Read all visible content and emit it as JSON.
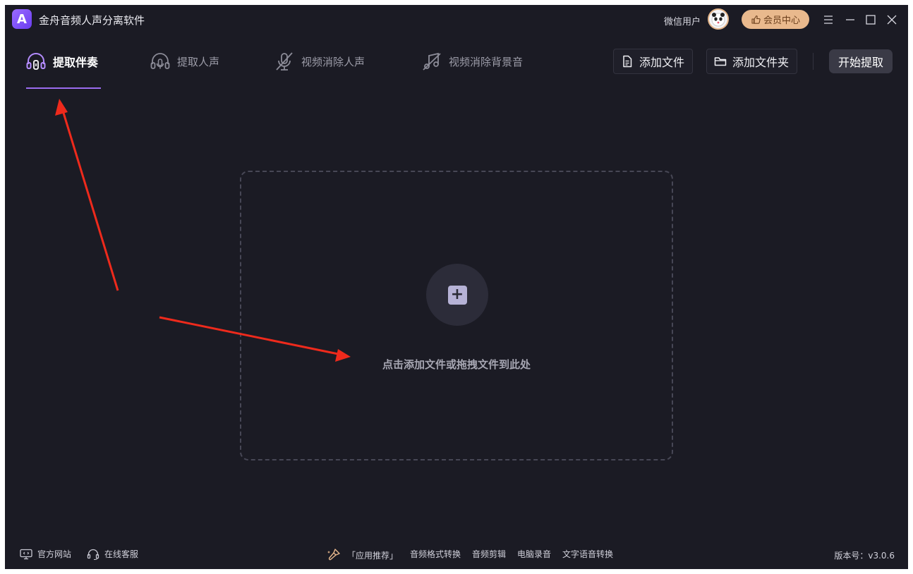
{
  "app": {
    "title": "金舟音频人声分离软件",
    "logo_letter": "A"
  },
  "user": {
    "name": "微信用户",
    "vip_label": "会员中心"
  },
  "tabs": [
    {
      "label": "提取伴奏",
      "icon": "headphones-icon",
      "active": true
    },
    {
      "label": "提取人声",
      "icon": "voice-headset-icon",
      "active": false
    },
    {
      "label": "视频消除人声",
      "icon": "mic-off-icon",
      "active": false
    },
    {
      "label": "视频消除背景音",
      "icon": "music-off-icon",
      "active": false
    }
  ],
  "toolbar": {
    "add_file": "添加文件",
    "add_folder": "添加文件夹",
    "start": "开始提取"
  },
  "dropzone": {
    "plus": "+",
    "text": "点击添加文件或拖拽文件到此处"
  },
  "footer": {
    "website": "官方网站",
    "support": "在线客服",
    "recommend": "「应用推荐」",
    "links": [
      "音频格式转换",
      "音频剪辑",
      "电脑录音",
      "文字语音转换"
    ],
    "version": "版本号：v3.0.6"
  },
  "colors": {
    "background": "#1b1b24",
    "accent": "#9b6cf0",
    "vip": "#e9b98d",
    "arrow": "#ee2a1c"
  }
}
